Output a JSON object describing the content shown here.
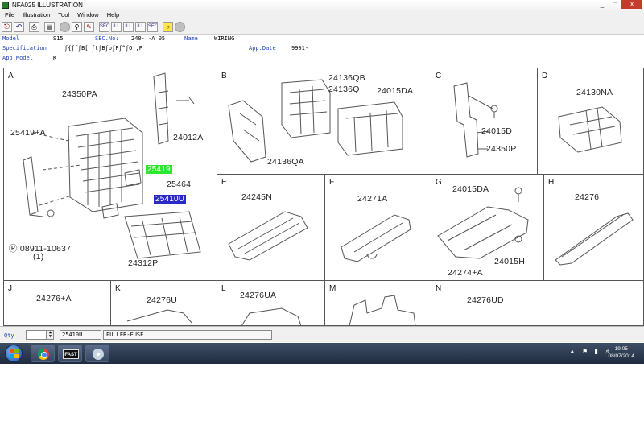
{
  "window": {
    "title": "NFA025 ILLUSTRATION",
    "buttons": [
      "_",
      "□",
      "X"
    ]
  },
  "menu": [
    "File",
    "Illustration",
    "Tool",
    "Window",
    "Help"
  ],
  "toolbar": {
    "icons": [
      "exit-icon",
      "undo-icon",
      "print-icon",
      "picture-icon",
      "record-icon",
      "zoom-icon",
      "notes-icon",
      "sec-icon",
      "ill-icon",
      "ill-icon",
      "ill-icon",
      "sec-icon",
      "bulb-icon",
      "circle-icon"
    ],
    "labels": [
      "",
      "",
      "",
      "",
      "",
      "",
      "",
      "SEC",
      "ILL",
      "ILL",
      "ILL",
      "SEC",
      "",
      ""
    ]
  },
  "info": {
    "model_label": "Model",
    "model_value": "S15",
    "secno_label": "SEC.No:",
    "secno_value": "240-  -A 05",
    "name_label": "Name",
    "name_value": "WIRING",
    "spec_label": "Specification",
    "spec_value": "ƒ{ƒfƒB[  ƒtƒBƒbƒFƒ^ƒO  ,P",
    "appdate_label": "App.Date",
    "appdate_value": "9901-",
    "appmodel_label": "App.Model",
    "appmodel_value": "K"
  },
  "cells": {
    "A": {
      "letter": "A",
      "parts": [
        "24350PA",
        "25419+A",
        "24012A",
        "25419",
        "25464",
        "25410U",
        "08911-10637",
        "(1)",
        "24312P"
      ]
    },
    "B": {
      "letter": "B",
      "parts": [
        "24136QB",
        "24136Q",
        "24015DA",
        "24136QA"
      ]
    },
    "C": {
      "letter": "C",
      "parts": [
        "24015D",
        "24350P"
      ]
    },
    "D": {
      "letter": "D",
      "parts": [
        "24130NA"
      ]
    },
    "E": {
      "letter": "E",
      "parts": [
        "24245N"
      ]
    },
    "F": {
      "letter": "F",
      "parts": [
        "24271A"
      ]
    },
    "G": {
      "letter": "G",
      "parts": [
        "24015DA",
        "24015H",
        "24274+A"
      ]
    },
    "H": {
      "letter": "H",
      "parts": [
        "24276"
      ]
    },
    "J": {
      "letter": "J",
      "parts": [
        "24276+A"
      ]
    },
    "K": {
      "letter": "K",
      "parts": [
        "24276U"
      ]
    },
    "L": {
      "letter": "L",
      "parts": [
        "24276UA"
      ]
    },
    "M": {
      "letter": "M",
      "parts": []
    },
    "N": {
      "letter": "N",
      "parts": [
        "24276UD"
      ]
    }
  },
  "colors": {
    "highlight_green": "#2ee62e",
    "highlight_blue": "#2a2ac8",
    "label_blue": "#1c3fb8"
  },
  "qty": {
    "label": "Qty",
    "value": "",
    "part_no": "25410U",
    "description": "PULLER-FUSE"
  },
  "taskbar": {
    "apps": [
      "chrome-icon",
      "fast-icon",
      "disc-icon"
    ],
    "fast_label": "FAST",
    "time": "19:05",
    "date": "08/07/2014"
  }
}
